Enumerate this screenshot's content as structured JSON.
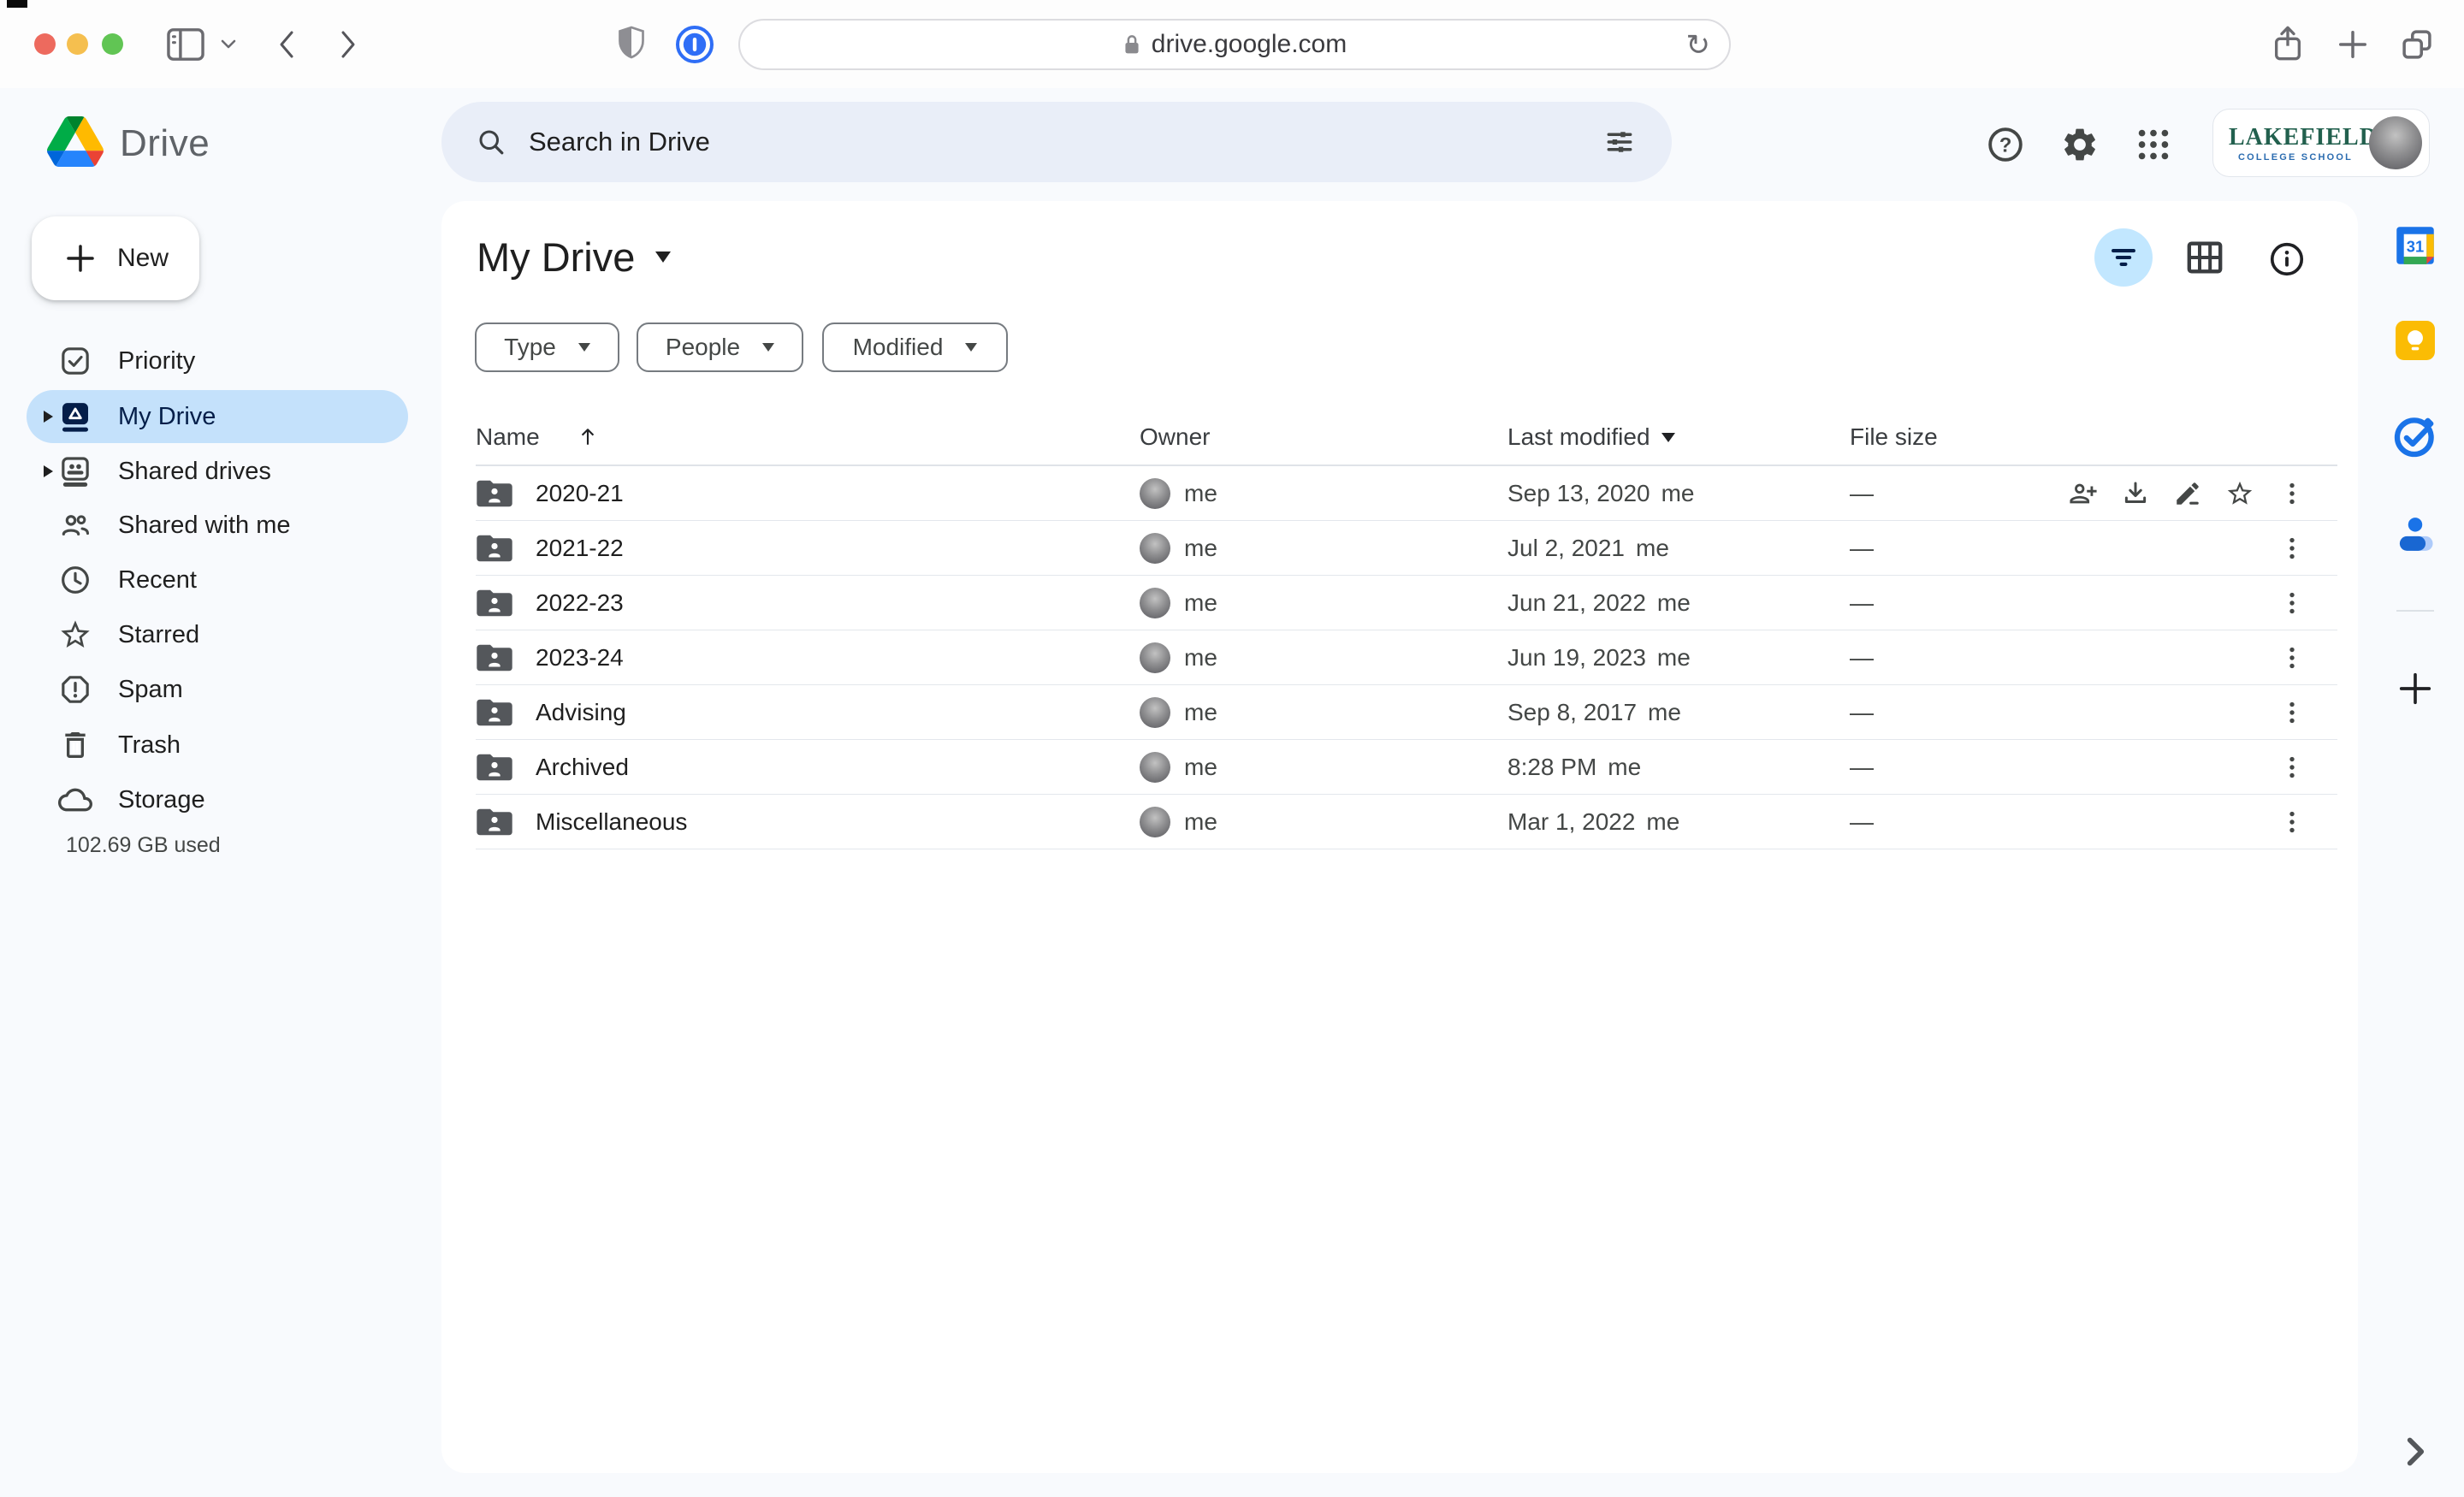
{
  "colors": {
    "page_bg": "#f8fafd",
    "card_bg": "#ffffff",
    "search_pill": "#e9eef8",
    "selected_item_bg": "#c4e1fb",
    "selected_item_text": "#041e49",
    "active_view_circle": "#c2e7ff",
    "text_primary": "#1f1f1f",
    "text_secondary": "#444746",
    "traffic_red": "#ed6a5e",
    "traffic_yellow": "#f5bf4f",
    "traffic_green": "#61c554",
    "keep_yellow": "#fbbc04",
    "google_blue": "#1a73e8",
    "lakefield_green": "#22604e",
    "lakefield_blue": "#2b6cb0"
  },
  "browser": {
    "url": "drive.google.com",
    "reload_glyph": "↻"
  },
  "header": {
    "app_name": "Drive",
    "search_placeholder": "Search in Drive",
    "account": {
      "line1": "LAKEFIELD",
      "line2": "COLLEGE SCHOOL"
    }
  },
  "sidebar": {
    "new_label": "New",
    "items": [
      {
        "label": "Priority"
      },
      {
        "label": "My Drive"
      },
      {
        "label": "Shared drives"
      },
      {
        "label": "Shared with me"
      },
      {
        "label": "Recent"
      },
      {
        "label": "Starred"
      },
      {
        "label": "Spam"
      },
      {
        "label": "Trash"
      },
      {
        "label": "Storage"
      }
    ],
    "storage_used": "102.69 GB used"
  },
  "main": {
    "title": "My Drive",
    "filters": {
      "type": "Type",
      "people": "People",
      "modified": "Modified"
    },
    "table": {
      "headers": {
        "name": "Name",
        "owner": "Owner",
        "modified": "Last modified",
        "size": "File size"
      },
      "rows": [
        {
          "name": "2020-21",
          "owner": "me",
          "modified": "Sep 13, 2020",
          "modified_by": "me",
          "size": "—"
        },
        {
          "name": "2021-22",
          "owner": "me",
          "modified": "Jul 2, 2021",
          "modified_by": "me",
          "size": "—"
        },
        {
          "name": "2022-23",
          "owner": "me",
          "modified": "Jun 21, 2022",
          "modified_by": "me",
          "size": "—"
        },
        {
          "name": "2023-24",
          "owner": "me",
          "modified": "Jun 19, 2023",
          "modified_by": "me",
          "size": "—"
        },
        {
          "name": "Advising",
          "owner": "me",
          "modified": "Sep 8, 2017",
          "modified_by": "me",
          "size": "—"
        },
        {
          "name": "Archived",
          "owner": "me",
          "modified": "8:28 PM",
          "modified_by": "me",
          "size": "—"
        },
        {
          "name": "Miscellaneous",
          "owner": "me",
          "modified": "Mar 1, 2022",
          "modified_by": "me",
          "size": "—"
        }
      ]
    }
  },
  "rail": {
    "calendar_day": "31"
  }
}
